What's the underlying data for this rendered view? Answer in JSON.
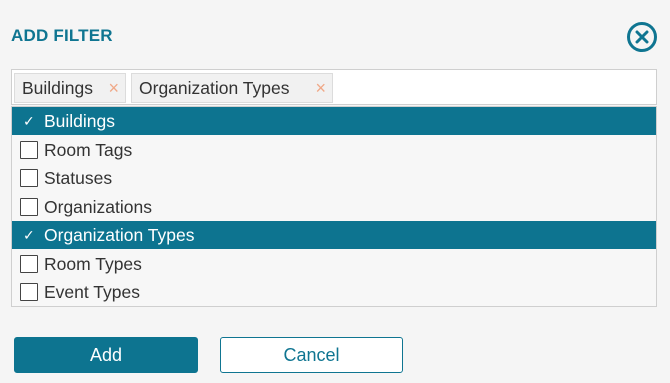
{
  "dialog": {
    "title": "ADD FILTER",
    "close_icon": "close-circle-icon"
  },
  "selected_tags": [
    {
      "label": "Buildings",
      "remove_glyph": "×"
    },
    {
      "label": "Organization Types",
      "remove_glyph": "×"
    }
  ],
  "options": [
    {
      "label": "Buildings",
      "checked": true
    },
    {
      "label": "Room Tags",
      "checked": false
    },
    {
      "label": "Statuses",
      "checked": false
    },
    {
      "label": "Organizations",
      "checked": false
    },
    {
      "label": "Organization Types",
      "checked": true
    },
    {
      "label": "Room Types",
      "checked": false
    },
    {
      "label": "Event Types",
      "checked": false
    }
  ],
  "check_glyph": "✓",
  "buttons": {
    "add": "Add",
    "cancel": "Cancel"
  },
  "colors": {
    "accent": "#0d7490",
    "title": "#0f7591",
    "remove_icon": "#f0a887",
    "background": "#f5f5f5"
  }
}
